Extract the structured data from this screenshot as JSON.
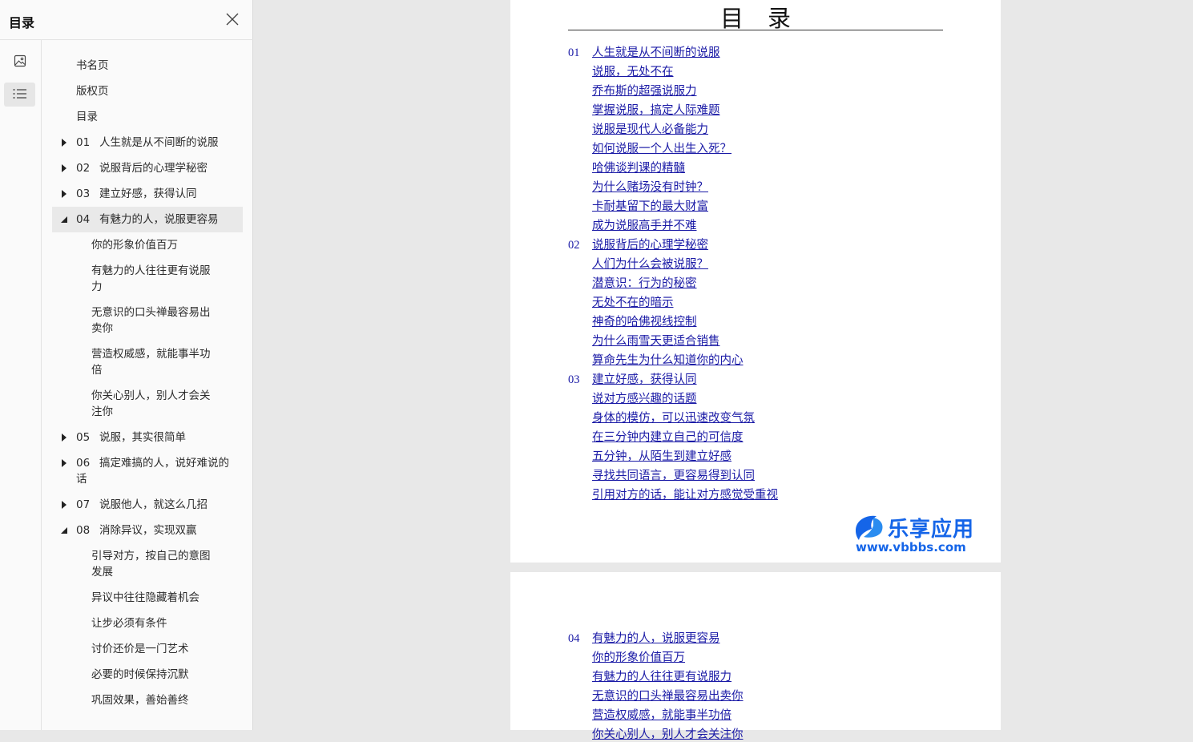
{
  "sidebar": {
    "title": "目录",
    "close_icon": "close-icon",
    "rail": [
      {
        "name": "thumbnail-view-button",
        "icon": "image-icon"
      },
      {
        "name": "toc-view-button",
        "icon": "list-icon"
      }
    ],
    "toc": [
      {
        "label": "书名页",
        "level": 0
      },
      {
        "label": "版权页",
        "level": 0
      },
      {
        "label": "目录",
        "level": 0
      },
      {
        "num": "01",
        "label": "人生就是从不间断的说服",
        "level": 0,
        "state": "collapsed"
      },
      {
        "num": "02",
        "label": "说服背后的心理学秘密",
        "level": 0,
        "state": "collapsed"
      },
      {
        "num": "03",
        "label": "建立好感，获得认同",
        "level": 0,
        "state": "collapsed"
      },
      {
        "num": "04",
        "label": "有魅力的人，说服更容易",
        "level": 0,
        "state": "expanded",
        "selected": true
      },
      {
        "label": "你的形象价值百万",
        "level": 1
      },
      {
        "label": "有魅力的人往往更有说服力",
        "level": 1
      },
      {
        "label": "无意识的口头禅最容易出卖你",
        "level": 1
      },
      {
        "label": "营造权威感，就能事半功倍",
        "level": 1
      },
      {
        "label": "你关心别人，别人才会关注你",
        "level": 1
      },
      {
        "num": "05",
        "label": "说服，其实很简单",
        "level": 0,
        "state": "collapsed"
      },
      {
        "num": "06",
        "label": "搞定难搞的人，说好难说的话",
        "level": 0,
        "state": "collapsed"
      },
      {
        "num": "07",
        "label": "说服他人，就这么几招",
        "level": 0,
        "state": "collapsed"
      },
      {
        "num": "08",
        "label": "消除异议，实现双赢",
        "level": 0,
        "state": "expanded"
      },
      {
        "label": "引导对方，按自己的意图发展",
        "level": 1
      },
      {
        "label": "异议中往往隐藏着机会",
        "level": 1
      },
      {
        "label": "让步必须有条件",
        "level": 1
      },
      {
        "label": "讨价还价是一门艺术",
        "level": 1
      },
      {
        "label": "必要的时候保持沉默",
        "level": 1
      },
      {
        "label": "巩固效果，善始善终",
        "level": 1
      }
    ]
  },
  "document": {
    "heading": "目录",
    "page1_links": [
      {
        "num": "01",
        "label": "人生就是从不间断的说服",
        "type": "ch"
      },
      {
        "label": "说服，无处不在",
        "type": "sec"
      },
      {
        "label": "乔布斯的超强说服力",
        "type": "sec"
      },
      {
        "label": "掌握说服，搞定人际难题",
        "type": "sec"
      },
      {
        "label": "说服是现代人必备能力",
        "type": "sec"
      },
      {
        "label": "如何说服一个人出生入死？",
        "type": "sec"
      },
      {
        "label": "哈佛谈判课的精髓",
        "type": "sec"
      },
      {
        "label": "为什么赌场没有时钟？",
        "type": "sec"
      },
      {
        "label": "卡耐基留下的最大财富",
        "type": "sec"
      },
      {
        "label": "成为说服高手并不难",
        "type": "sec"
      },
      {
        "num": "02",
        "label": "说服背后的心理学秘密",
        "type": "ch"
      },
      {
        "label": "人们为什么会被说服？",
        "type": "sec"
      },
      {
        "label": "潜意识：行为的秘密",
        "type": "sec"
      },
      {
        "label": "无处不在的暗示",
        "type": "sec"
      },
      {
        "label": "神奇的哈佛视线控制",
        "type": "sec"
      },
      {
        "label": "为什么雨雪天更适合销售",
        "type": "sec"
      },
      {
        "label": "算命先生为什么知道你的内心",
        "type": "sec"
      },
      {
        "num": "03",
        "label": "建立好感，获得认同",
        "type": "ch"
      },
      {
        "label": "说对方感兴趣的话题",
        "type": "sec"
      },
      {
        "label": "身体的模仿，可以迅速改变气氛",
        "type": "sec"
      },
      {
        "label": "在三分钟内建立自己的可信度",
        "type": "sec"
      },
      {
        "label": "五分钟，从陌生到建立好感",
        "type": "sec"
      },
      {
        "label": "寻找共同语言，更容易得到认同",
        "type": "sec"
      },
      {
        "label": "引用对方的话，能让对方感觉受重视",
        "type": "sec"
      }
    ],
    "page2_links": [
      {
        "num": "04",
        "label": "有魅力的人，说服更容易",
        "type": "ch"
      },
      {
        "label": "你的形象价值百万",
        "type": "sec"
      },
      {
        "label": "有魅力的人往往更有说服力",
        "type": "sec"
      },
      {
        "label": "无意识的口头禅最容易出卖你",
        "type": "sec"
      },
      {
        "label": "营造权威感，就能事半功倍",
        "type": "sec"
      },
      {
        "label": "你关心别人，别人才会关注你",
        "type": "sec"
      }
    ]
  },
  "watermark": {
    "name": "乐享应用",
    "url": "www.vbbbs.com"
  },
  "colors": {
    "link": "#1a1aa6",
    "sidebar_bg": "#fafafa",
    "workspace_bg": "#e8e8e8",
    "watermark": "#1565e8"
  }
}
